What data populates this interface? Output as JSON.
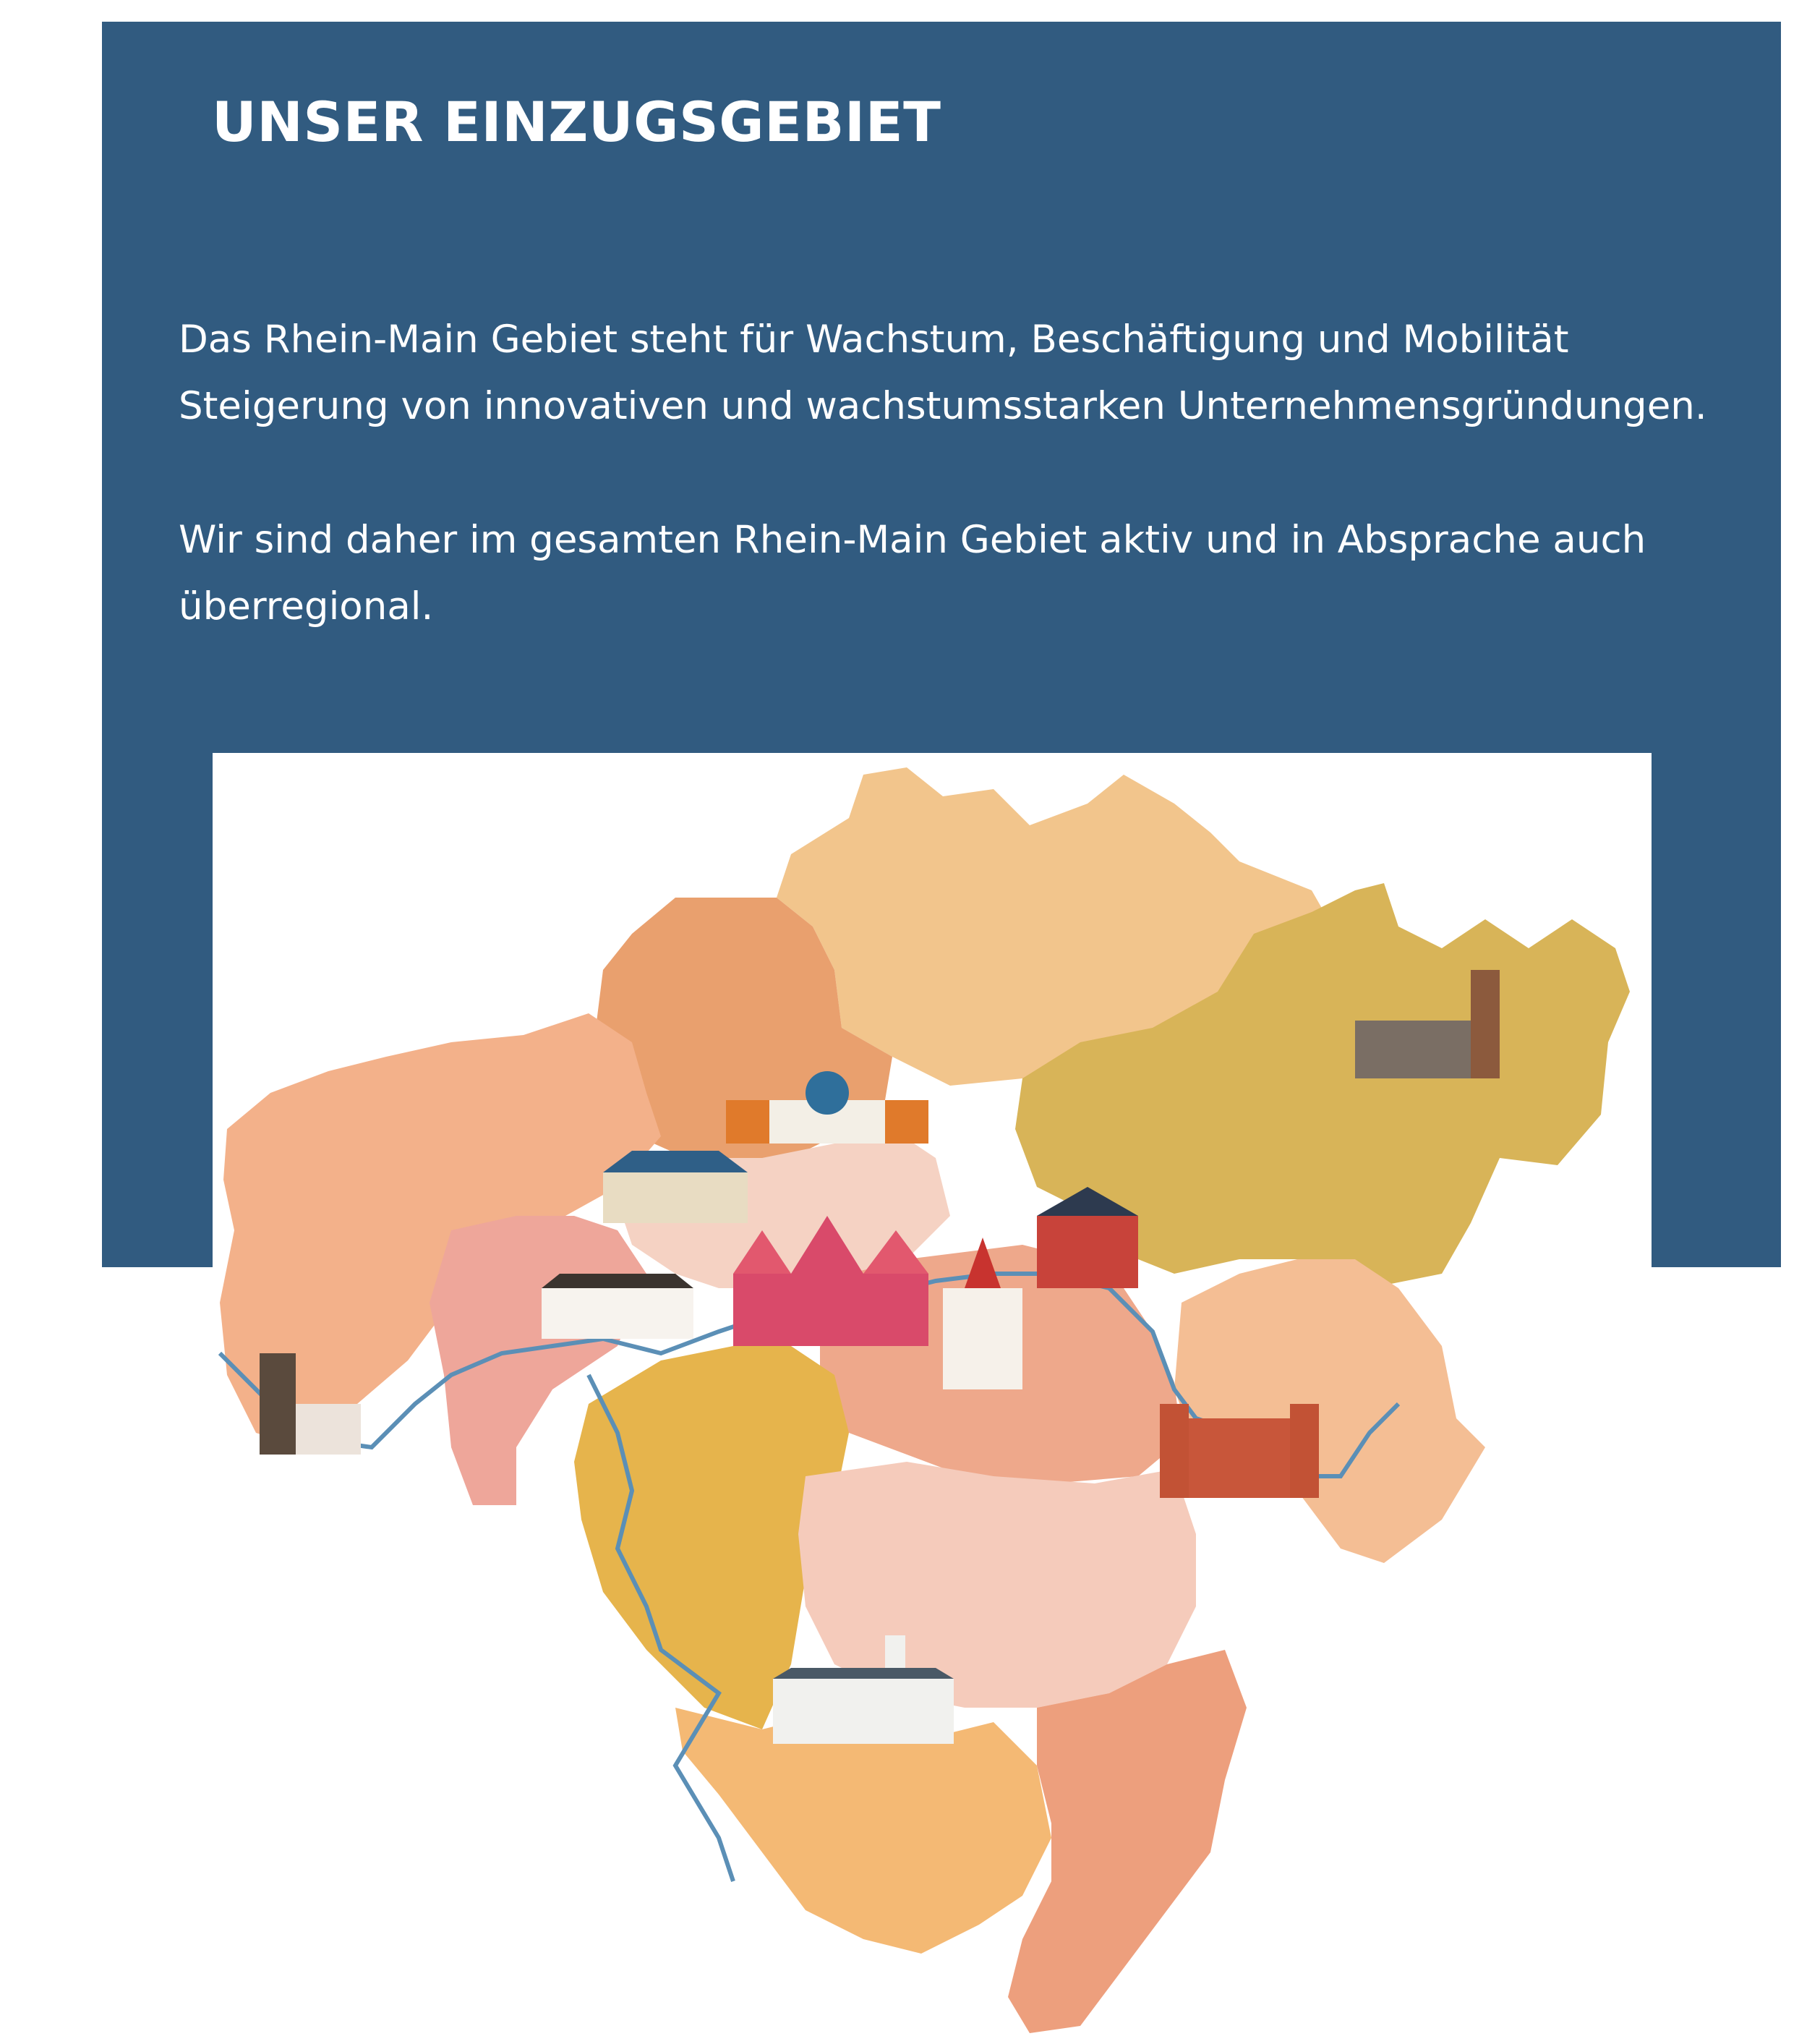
{
  "section": {
    "title": "UNSER EINZUGSGEBIET",
    "paragraph_1": "Das Rhein-Main Gebiet steht für Wachstum, Beschäftigung und Mobilität Steigerung von innovativen und wachstumsstarken Unternehmensgründungen.",
    "paragraph_2": "Wir sind daher im gesamten Rhein-Main Gebiet aktiv und in Absprache auch überregional."
  },
  "colors": {
    "panel_background": "#315b80",
    "text": "#ffffff",
    "river": "#5b8fb6"
  },
  "map": {
    "regions": [
      {
        "name": "region-north",
        "color": "#f2c58c"
      },
      {
        "name": "region-north-west",
        "color": "#e9a06e"
      },
      {
        "name": "region-west",
        "color": "#f3b18a"
      },
      {
        "name": "region-east",
        "color": "#d8b458"
      },
      {
        "name": "region-south-west",
        "color": "#e6b44c"
      },
      {
        "name": "region-south",
        "color": "#f4b974"
      }
    ],
    "landmarks": [
      "domed-palace-icon",
      "villa-icon",
      "roemer-town-hall-icon",
      "church-tower-icon",
      "red-town-hall-icon",
      "half-timbered-houses-icon",
      "castle-tower-icon",
      "hilltop-castle-icon",
      "palace-red-icon",
      "white-palace-icon"
    ]
  }
}
